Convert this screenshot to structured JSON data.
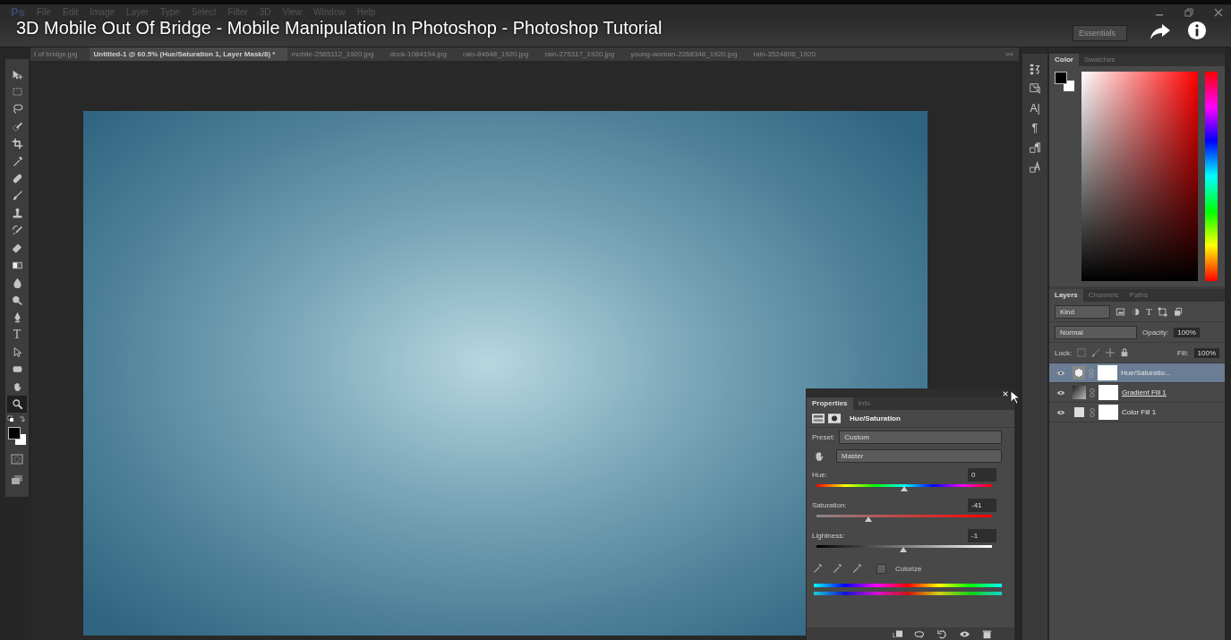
{
  "menu": {
    "app_logo": "Ps",
    "items": [
      "File",
      "Edit",
      "Image",
      "Layer",
      "Type",
      "Select",
      "Filter",
      "3D",
      "View",
      "Window",
      "Help"
    ]
  },
  "video_title": "3D Mobile Out Of Bridge - Mobile Manipulation In Photoshop - Photoshop Tutorial",
  "workspace": "Essentials",
  "document_tabs": [
    {
      "label": "t of bridge.jpg",
      "selected": false
    },
    {
      "label": "Untitled-1 @ 60.5% (Hue/Saturation 1, Layer Mask/8) *",
      "selected": true
    },
    {
      "label": "mobile-2565112_1920.jpg",
      "selected": false
    },
    {
      "label": "dock-1084194.jpg",
      "selected": false
    },
    {
      "label": "rain-84648_1920.jpg",
      "selected": false
    },
    {
      "label": "rain-275317_1920.jpg",
      "selected": false
    },
    {
      "label": "young-woman-2268348_1920.jpg",
      "selected": false
    },
    {
      "label": "rain-3524806_1920.",
      "selected": false
    }
  ],
  "tab_overflow": ">>",
  "tools": [
    {
      "kind": "move",
      "selected": false
    },
    {
      "kind": "marquee",
      "selected": false
    },
    {
      "kind": "lasso",
      "selected": false
    },
    {
      "kind": "quick-select",
      "selected": false
    },
    {
      "kind": "crop",
      "selected": false
    },
    {
      "kind": "eyedropper",
      "selected": false
    },
    {
      "kind": "healing",
      "selected": false
    },
    {
      "kind": "brush",
      "selected": false
    },
    {
      "kind": "stamp",
      "selected": false
    },
    {
      "kind": "history-brush",
      "selected": false
    },
    {
      "kind": "eraser",
      "selected": false
    },
    {
      "kind": "gradient",
      "selected": false
    },
    {
      "kind": "blur",
      "selected": false
    },
    {
      "kind": "dodge",
      "selected": false
    },
    {
      "kind": "pen",
      "selected": false
    },
    {
      "kind": "type",
      "glyph": "T",
      "selected": false
    },
    {
      "kind": "path-select",
      "selected": false
    },
    {
      "kind": "shape",
      "selected": false
    },
    {
      "kind": "hand",
      "selected": false
    },
    {
      "kind": "zoom",
      "selected": true
    }
  ],
  "dock_panels": [
    {
      "kind": "history"
    },
    {
      "kind": "navigator"
    },
    {
      "kind": "character",
      "glyph": "A|"
    },
    {
      "kind": "paragraph",
      "glyph": "¶"
    },
    {
      "kind": "paragraph-styles"
    },
    {
      "kind": "character-styles"
    }
  ],
  "color_panel": {
    "tabs": [
      {
        "label": "Color",
        "selected": true
      },
      {
        "label": "Swatches",
        "selected": false
      }
    ]
  },
  "layers_panel": {
    "tabs": [
      {
        "label": "Layers",
        "selected": true
      },
      {
        "label": "Channels",
        "selected": false
      },
      {
        "label": "Paths",
        "selected": false
      }
    ],
    "filter": "Kind",
    "filter_icons": [
      {
        "kind": "pixel"
      },
      {
        "kind": "adjustment"
      },
      {
        "kind": "type",
        "glyph": "T"
      },
      {
        "kind": "shape"
      },
      {
        "kind": "smart"
      }
    ],
    "blend_mode": "Normal",
    "opacity_label": "Opacity:",
    "opacity": "100%",
    "lock_label": "Lock:",
    "fill_label": "Fill:",
    "fill": "100%",
    "layers": [
      {
        "name": "Hue/Saturatio...",
        "kind": "adjustment",
        "selected": true,
        "visible": true,
        "underlined": false
      },
      {
        "name": "Gradient Fill 1",
        "kind": "gradient",
        "selected": false,
        "visible": true,
        "underlined": true
      },
      {
        "name": "Color Fill 1",
        "kind": "solid",
        "selected": false,
        "visible": true,
        "underlined": false
      }
    ]
  },
  "properties_panel": {
    "tabs": [
      {
        "label": "Properties",
        "selected": true
      },
      {
        "label": "Info",
        "selected": false
      }
    ],
    "title": "Hue/Saturation",
    "preset_label": "Preset:",
    "preset": "Custom",
    "channel": "Master",
    "sliders": [
      {
        "kind": "hue",
        "label": "Hue:",
        "value": "0",
        "level": 0.5
      },
      {
        "kind": "saturation",
        "label": "Saturation:",
        "value": "-41",
        "level": 0.295
      },
      {
        "kind": "lightness",
        "label": "Lightness:",
        "value": "-1",
        "level": 0.495
      }
    ],
    "colorize": {
      "label": "Colorize",
      "checked": false
    }
  }
}
